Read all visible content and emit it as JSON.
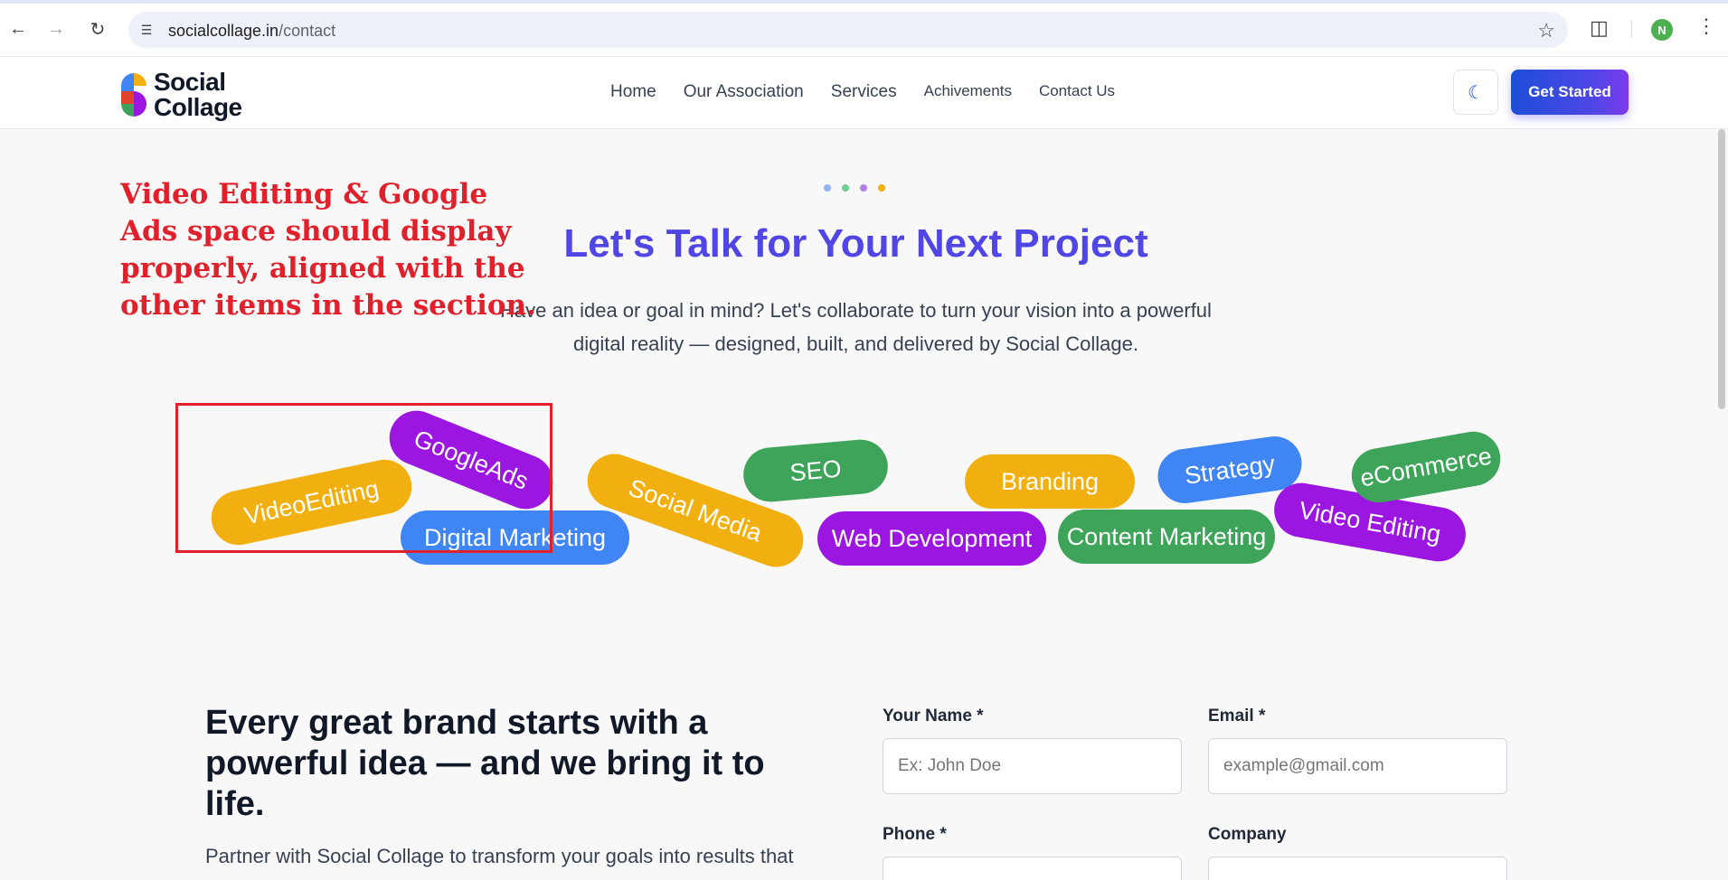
{
  "browser": {
    "url_host": "socialcollage.in",
    "url_path": "/contact",
    "profile_initial": "N",
    "icons": [
      "back-icon",
      "forward-icon",
      "reload-icon",
      "site-settings-icon",
      "bookmark-star-icon",
      "extensions-icon",
      "more-icon"
    ]
  },
  "header": {
    "logo_line1": "Social",
    "logo_line2": "Collage",
    "nav": [
      {
        "label": "Home"
      },
      {
        "label": "Our Association"
      },
      {
        "label": "Services"
      },
      {
        "label": "Achivements"
      },
      {
        "label": "Contact Us"
      }
    ],
    "theme_icon": "moon-icon",
    "cta_label": "Get Started"
  },
  "hero": {
    "dot_colors": [
      "#93b4f4",
      "#6fcf97",
      "#b37feb",
      "#f2b010"
    ],
    "title": "Let's Talk for Your Next Project",
    "description": "Have an idea or goal in mind? Let's collaborate to turn your vision into a powerful digital reality — designed, built, and delivered by Social Collage."
  },
  "annotation": {
    "text": "Video Editing & Google Ads space should display properly, aligned with the other items in the section."
  },
  "tags": [
    {
      "label": "VideoEditing"
    },
    {
      "label": "GoogleAds"
    },
    {
      "label": "Digital Marketing"
    },
    {
      "label": "Social Media"
    },
    {
      "label": "SEO"
    },
    {
      "label": "Web Development"
    },
    {
      "label": "Branding"
    },
    {
      "label": "Content Marketing"
    },
    {
      "label": "Strategy"
    },
    {
      "label": "Video Editing"
    },
    {
      "label": "eCommerce"
    }
  ],
  "intro": {
    "heading": "Every great brand starts with a powerful idea — and we bring it to life.",
    "paragraph": "Partner with Social Collage to transform your goals into results that"
  },
  "form": {
    "name_label": "Your Name *",
    "name_placeholder": "Ex: John Doe",
    "email_label": "Email *",
    "email_placeholder": "example@gmail.com",
    "phone_label": "Phone *",
    "company_label": "Company"
  }
}
